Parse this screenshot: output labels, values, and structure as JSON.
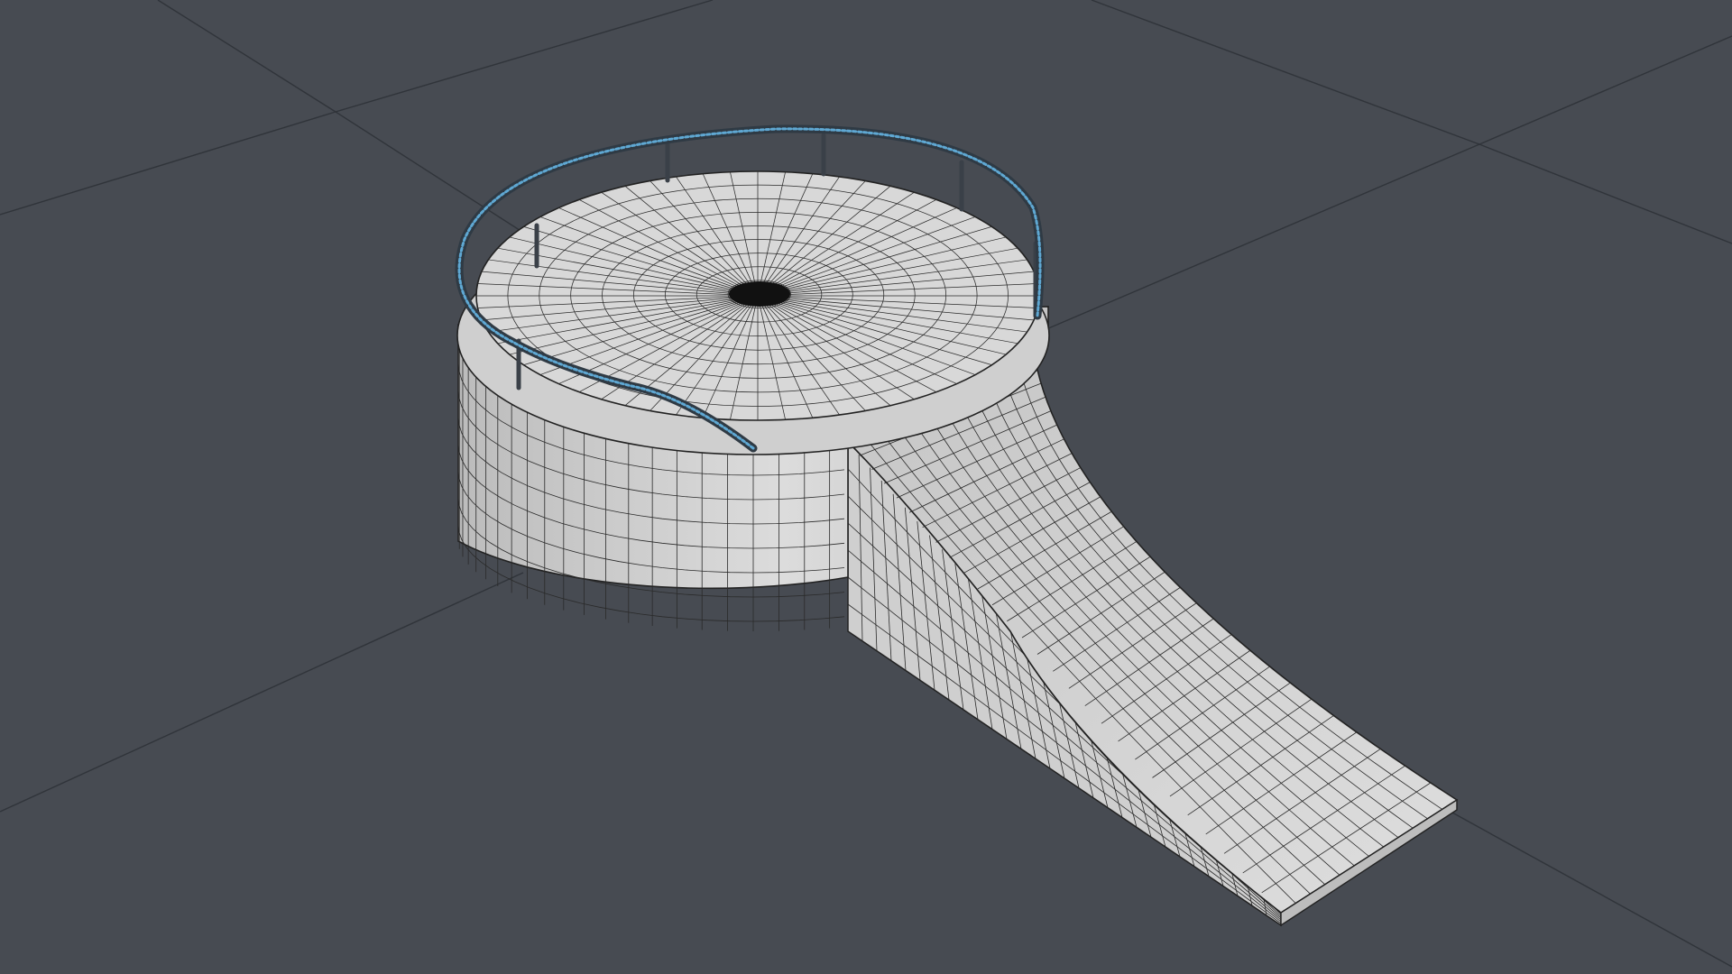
{
  "viewport": {
    "background_color": "#474b52",
    "grid_line_color": "#30343a",
    "mesh_surface_color": "#d7d7d7",
    "mesh_shade_color": "#bdbdbd",
    "wireframe_color": "#222222",
    "selection_color": "#5fa8d3",
    "railing_color": "#3a4048"
  },
  "scene": {
    "objects": [
      {
        "name": "cylinder-platform",
        "icon": "mesh-object-icon"
      },
      {
        "name": "ramp",
        "icon": "mesh-object-icon"
      },
      {
        "name": "railing",
        "icon": "mesh-object-icon",
        "selected": true
      }
    ]
  }
}
